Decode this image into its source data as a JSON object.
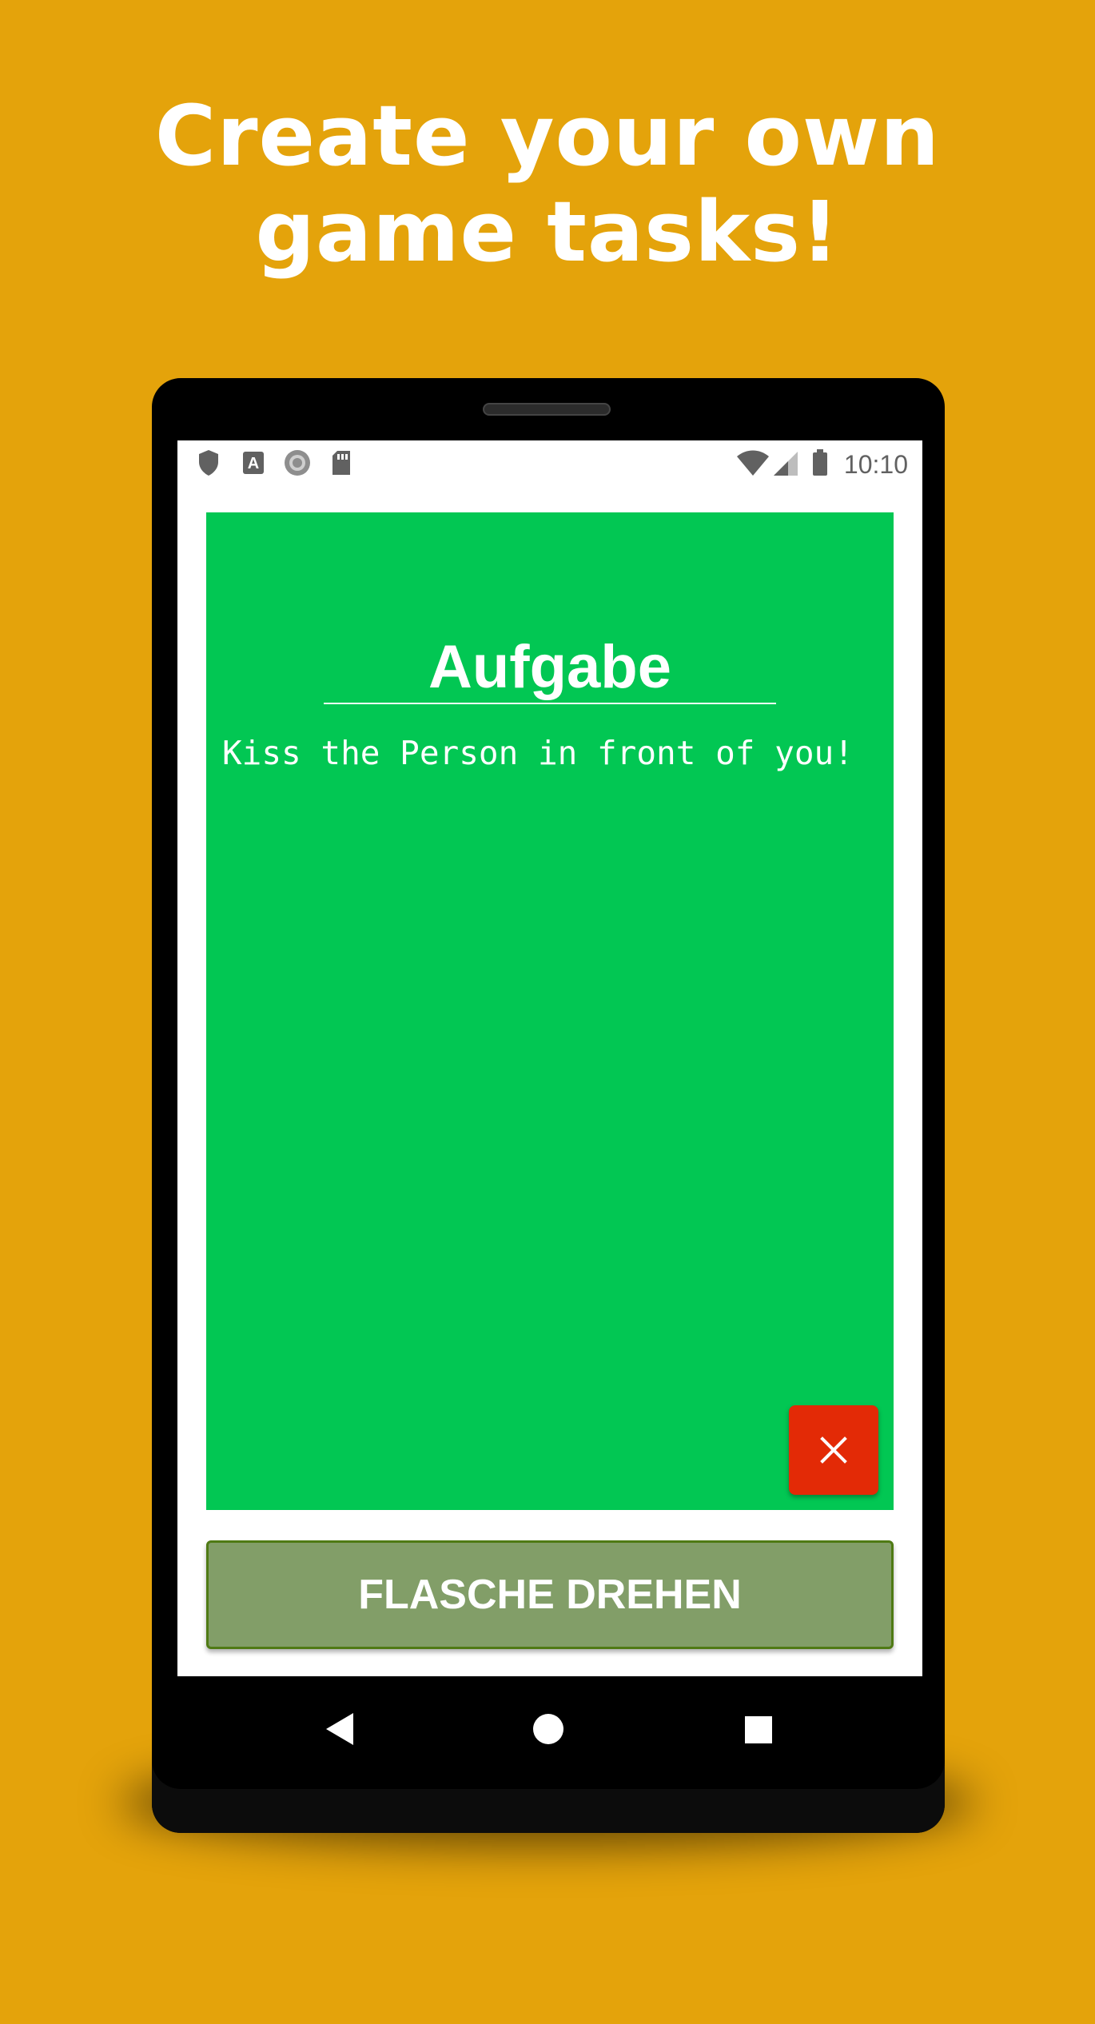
{
  "promo": {
    "headline_line1": "Create your own",
    "headline_line2": "game tasks!"
  },
  "statusbar": {
    "left_icons": [
      "shield-icon",
      "text-a-icon",
      "circle-record-icon",
      "sd-card-icon"
    ],
    "right_icons": [
      "wifi-icon",
      "cell-signal-icon",
      "battery-icon"
    ],
    "time": "10:10"
  },
  "card": {
    "title": "Aufgabe",
    "text": "Kiss the Person in front of you!",
    "close_icon": "close-icon",
    "background": "#02C753",
    "close_color": "#E32A06"
  },
  "actions": {
    "spin_label": "FLASCHE DREHEN",
    "spin_color": "#829E68"
  },
  "navbar": {
    "back": "back-triangle-icon",
    "home": "home-circle-icon",
    "recents": "recents-square-icon"
  },
  "colors": {
    "page_background": "#E4A30B"
  }
}
